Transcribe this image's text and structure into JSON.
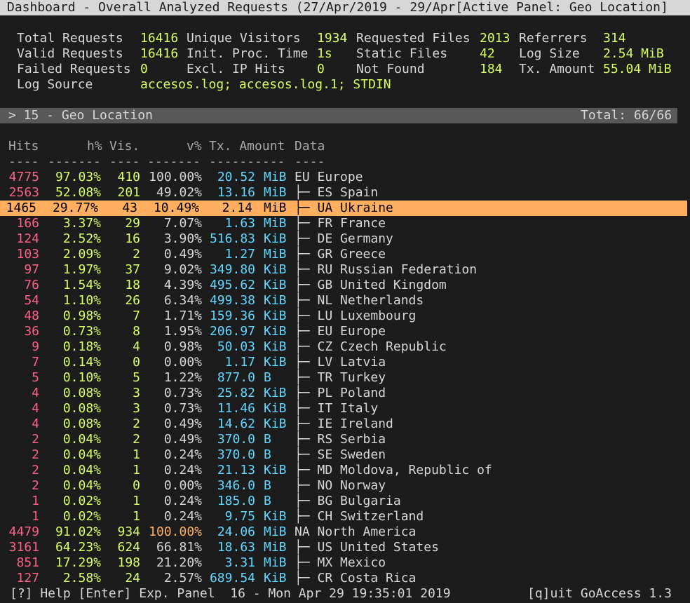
{
  "title_bar": "Dashboard - Overall Analyzed Requests (27/Apr/2019 - 29/Apr[Active Panel: Geo Location]",
  "stats": {
    "total_requests_label": "Total Requests",
    "total_requests": "16416",
    "valid_requests_label": "Valid Requests",
    "valid_requests": "16416",
    "failed_requests_label": "Failed Requests",
    "failed_requests": "0",
    "log_source_label": "Log Source",
    "log_source": "accesos.log; accesos.log.1; STDIN",
    "unique_visitors_label": "Unique Visitors",
    "unique_visitors": "1934",
    "init_proc_time_label": "Init. Proc. Time",
    "init_proc_time": "1s",
    "excl_ip_hits_label": "Excl. IP Hits",
    "excl_ip_hits": "0",
    "requested_files_label": "Requested Files",
    "requested_files": "2013",
    "static_files_label": "Static Files",
    "static_files": "42",
    "not_found_label": "Not Found",
    "not_found": "184",
    "referrers_label": "Referrers",
    "referrers": "314",
    "log_size_label": "Log Size",
    "log_size": "2.54 MiB",
    "tx_amount_label": "Tx. Amount",
    "tx_amount": "55.04 MiB"
  },
  "panel": {
    "title": "> 15 - Geo Location",
    "total": "Total: 66/66"
  },
  "columns": {
    "hits": "Hits",
    "hp": "h%",
    "vis": "Vis.",
    "vp": "v%",
    "tx": "Tx. Amount",
    "data": "Data",
    "sep_hits": "----",
    "sep_hp": "-------",
    "sep_vis": "----",
    "sep_vp": "-------",
    "sep_tx": "----------",
    "sep_data": "----"
  },
  "rows": [
    {
      "hits": "4775",
      "hp": "97.03%",
      "vis": "410",
      "vp": "100.00%",
      "tx_num": "20.52",
      "tx_unit": "MiB",
      "data": "EU Europe",
      "child": false
    },
    {
      "hits": "2563",
      "hp": "52.08%",
      "vis": "201",
      "vp": "49.02%",
      "tx_num": "13.16",
      "tx_unit": "MiB",
      "data": "├─ ES Spain",
      "child": true
    },
    {
      "hits": "1465",
      "hp": "29.77%",
      "vis": "43",
      "vp": "10.49%",
      "tx_num": "2.14",
      "tx_unit": "MiB",
      "data": "├─ UA Ukraine",
      "child": true,
      "selected": true
    },
    {
      "hits": "166",
      "hp": "3.37%",
      "vis": "29",
      "vp": "7.07%",
      "tx_num": "1.63",
      "tx_unit": "MiB",
      "data": "├─ FR France",
      "child": true
    },
    {
      "hits": "124",
      "hp": "2.52%",
      "vis": "16",
      "vp": "3.90%",
      "tx_num": "516.83",
      "tx_unit": "KiB",
      "data": "├─ DE Germany",
      "child": true
    },
    {
      "hits": "103",
      "hp": "2.09%",
      "vis": "2",
      "vp": "0.49%",
      "tx_num": "1.27",
      "tx_unit": "MiB",
      "data": "├─ GR Greece",
      "child": true
    },
    {
      "hits": "97",
      "hp": "1.97%",
      "vis": "37",
      "vp": "9.02%",
      "tx_num": "349.80",
      "tx_unit": "KiB",
      "data": "├─ RU Russian Federation",
      "child": true
    },
    {
      "hits": "76",
      "hp": "1.54%",
      "vis": "18",
      "vp": "4.39%",
      "tx_num": "495.62",
      "tx_unit": "KiB",
      "data": "├─ GB United Kingdom",
      "child": true
    },
    {
      "hits": "54",
      "hp": "1.10%",
      "vis": "26",
      "vp": "6.34%",
      "tx_num": "499.38",
      "tx_unit": "KiB",
      "data": "├─ NL Netherlands",
      "child": true
    },
    {
      "hits": "48",
      "hp": "0.98%",
      "vis": "7",
      "vp": "1.71%",
      "tx_num": "159.36",
      "tx_unit": "KiB",
      "data": "├─ LU Luxembourg",
      "child": true
    },
    {
      "hits": "36",
      "hp": "0.73%",
      "vis": "8",
      "vp": "1.95%",
      "tx_num": "206.97",
      "tx_unit": "KiB",
      "data": "├─ EU Europe",
      "child": true
    },
    {
      "hits": "9",
      "hp": "0.18%",
      "vis": "4",
      "vp": "0.98%",
      "tx_num": "50.03",
      "tx_unit": "KiB",
      "data": "├─ CZ Czech Republic",
      "child": true
    },
    {
      "hits": "7",
      "hp": "0.14%",
      "vis": "0",
      "vp": "0.00%",
      "tx_num": "1.17",
      "tx_unit": "KiB",
      "data": "├─ LV Latvia",
      "child": true
    },
    {
      "hits": "5",
      "hp": "0.10%",
      "vis": "5",
      "vp": "1.22%",
      "tx_num": "877.0",
      "tx_unit": "B",
      "data": "├─ TR Turkey",
      "child": true
    },
    {
      "hits": "4",
      "hp": "0.08%",
      "vis": "3",
      "vp": "0.73%",
      "tx_num": "25.82",
      "tx_unit": "KiB",
      "data": "├─ PL Poland",
      "child": true
    },
    {
      "hits": "4",
      "hp": "0.08%",
      "vis": "3",
      "vp": "0.73%",
      "tx_num": "11.46",
      "tx_unit": "KiB",
      "data": "├─ IT Italy",
      "child": true
    },
    {
      "hits": "4",
      "hp": "0.08%",
      "vis": "2",
      "vp": "0.49%",
      "tx_num": "14.62",
      "tx_unit": "KiB",
      "data": "├─ IE Ireland",
      "child": true
    },
    {
      "hits": "2",
      "hp": "0.04%",
      "vis": "2",
      "vp": "0.49%",
      "tx_num": "370.0",
      "tx_unit": "B",
      "data": "├─ RS Serbia",
      "child": true
    },
    {
      "hits": "2",
      "hp": "0.04%",
      "vis": "1",
      "vp": "0.24%",
      "tx_num": "370.0",
      "tx_unit": "B",
      "data": "├─ SE Sweden",
      "child": true
    },
    {
      "hits": "2",
      "hp": "0.04%",
      "vis": "1",
      "vp": "0.24%",
      "tx_num": "21.13",
      "tx_unit": "KiB",
      "data": "├─ MD Moldova, Republic of",
      "child": true
    },
    {
      "hits": "2",
      "hp": "0.04%",
      "vis": "0",
      "vp": "0.00%",
      "tx_num": "346.0",
      "tx_unit": "B",
      "data": "├─ NO Norway",
      "child": true
    },
    {
      "hits": "1",
      "hp": "0.02%",
      "vis": "1",
      "vp": "0.24%",
      "tx_num": "185.0",
      "tx_unit": "B",
      "data": "├─ BG Bulgaria",
      "child": true
    },
    {
      "hits": "1",
      "hp": "0.02%",
      "vis": "1",
      "vp": "0.24%",
      "tx_num": "9.75",
      "tx_unit": "KiB",
      "data": "├─ CH Switzerland",
      "child": true
    },
    {
      "hits": "4479",
      "hp": "91.02%",
      "vis": "934",
      "vp": "100.00%",
      "tx_num": "24.06",
      "tx_unit": "MiB",
      "data": "NA North America",
      "child": false,
      "vp_highlight": true
    },
    {
      "hits": "3161",
      "hp": "64.23%",
      "vis": "624",
      "vp": "66.81%",
      "tx_num": "18.63",
      "tx_unit": "MiB",
      "data": "├─ US United States",
      "child": true
    },
    {
      "hits": "851",
      "hp": "17.29%",
      "vis": "198",
      "vp": "21.20%",
      "tx_num": "3.31",
      "tx_unit": "MiB",
      "data": "├─ MX Mexico",
      "child": true
    },
    {
      "hits": "127",
      "hp": "2.58%",
      "vis": "24",
      "vp": "2.57%",
      "tx_num": "689.54",
      "tx_unit": "KiB",
      "data": "├─ CR Costa Rica",
      "child": true
    }
  ],
  "footer": {
    "left": "[?] Help [Enter] Exp. Panel  16 - Mon Apr 29 19:35:01 2019",
    "right": "[q]uit GoAccess 1.3"
  },
  "colors": {
    "background": "#1c1c1c",
    "hits": "#ff5f87",
    "percent": "#d7ff5f",
    "bandwidth": "#5fd7ff",
    "selected_row": "#ffaf5f",
    "panel_bar": "#585858",
    "title_bar": "#d7d7d7"
  }
}
